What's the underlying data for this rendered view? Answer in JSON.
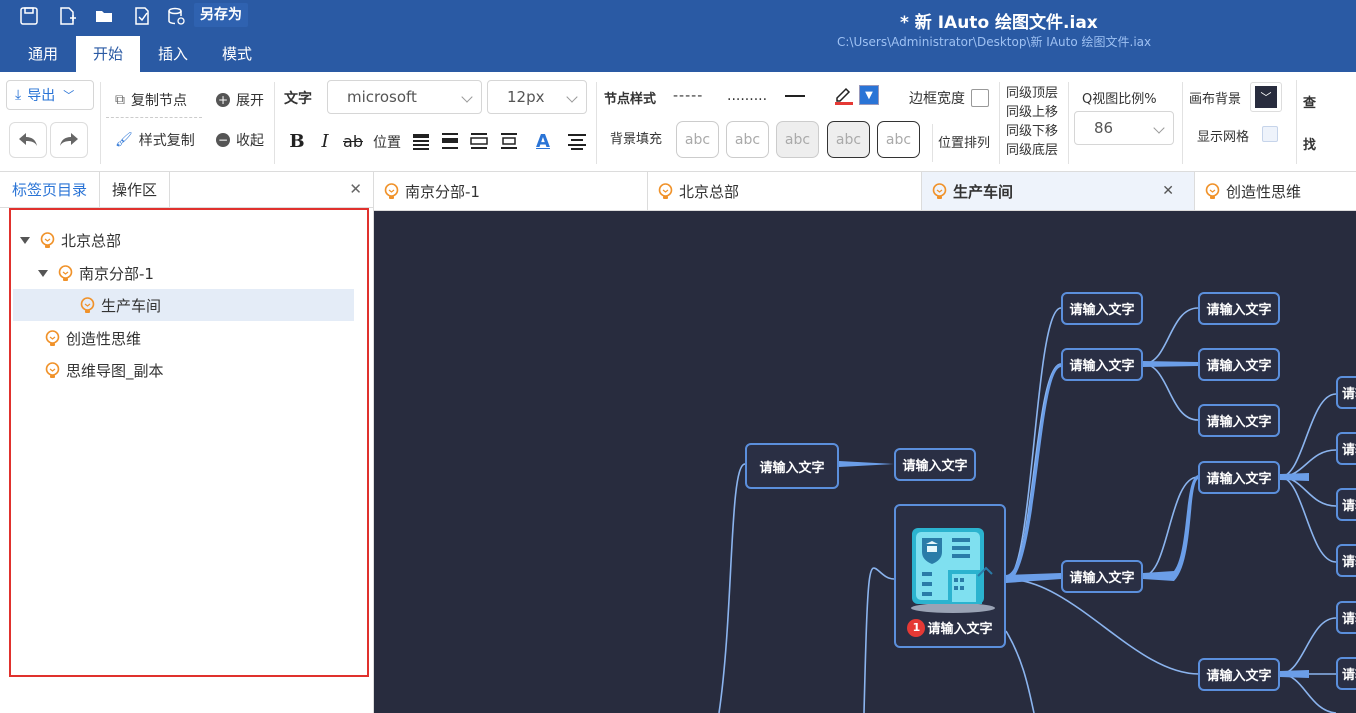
{
  "titlebar": {
    "title": "*  新 IAuto 绘图文件.iax",
    "path": "C:\\Users\\Administrator\\Desktop\\新 IAuto 绘图文件.iax",
    "save_as": "另存为"
  },
  "menu": [
    "通用",
    "开始",
    "插入",
    "模式"
  ],
  "ribbon": {
    "export": "导出",
    "copy_node": "复制节点",
    "style_copy": "样式复制",
    "expand": "展开",
    "collapse": "收起",
    "text_label": "文字",
    "font": "microsoft",
    "font_size": "12px",
    "position": "位置",
    "node_style": "节点样式",
    "bg_fill": "背景填充",
    "border_width": "边框宽度",
    "arrange": "位置排列",
    "sib_top": "同级顶层",
    "sib_up": "同级上移",
    "sib_down": "同级下移",
    "sib_bottom": "同级底层",
    "zoom_label": "Q视图比例%",
    "zoom_value": "86",
    "canvas_bg": "画布背景",
    "show_grid": "显示网格",
    "find1": "查",
    "find2": "找",
    "abc": "abc"
  },
  "sidebar": {
    "tab1": "标签页目录",
    "tab2": "操作区",
    "tree": [
      "北京总部",
      "南京分部-1",
      "生产车间",
      "创造性思维",
      "思维导图_副本"
    ]
  },
  "doc_tabs": [
    "南京分部-1",
    "北京总部",
    "生产车间",
    "创造性思维"
  ],
  "canvas": {
    "node_text": "请输入文字",
    "badge": "1",
    "center_label": "请输入文字"
  }
}
